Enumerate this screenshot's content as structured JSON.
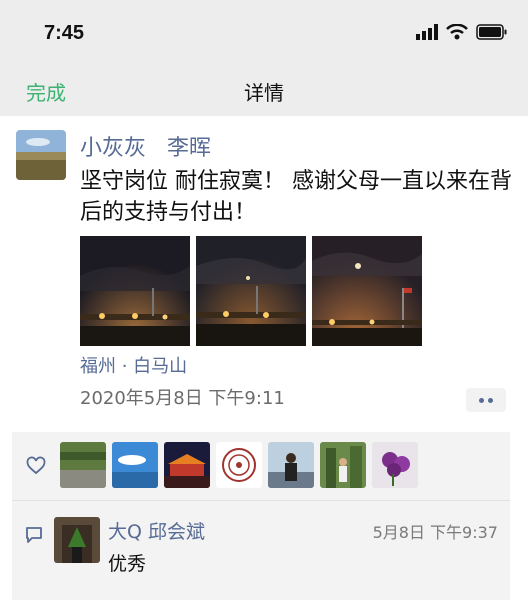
{
  "status_bar": {
    "time": "7:45"
  },
  "nav": {
    "done": "完成",
    "title": "详情"
  },
  "post": {
    "names": [
      "小灰灰",
      "李晖"
    ],
    "content": "坚守岗位 耐住寂寞！ 感谢父母一直以来在背后的支持与付出！",
    "location": "福州 · 白马山",
    "datetime": "2020年5月8日 下午9:11"
  },
  "comment": {
    "name": "大Q 邱会斌",
    "time": "5月8日 下午9:37",
    "text": "优秀"
  },
  "colors": {
    "link": "#576b95",
    "done_green": "#3cb371",
    "panel": "#f3f3f3"
  }
}
